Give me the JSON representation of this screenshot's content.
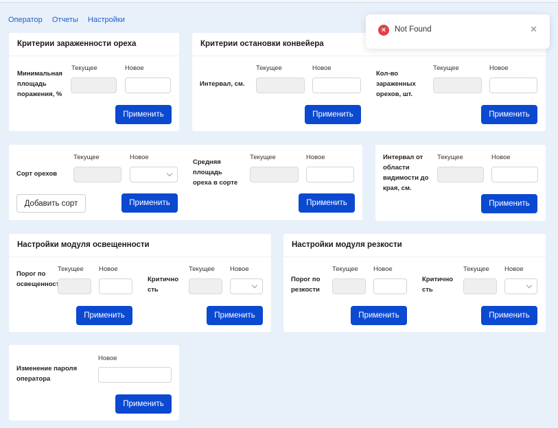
{
  "nav": {
    "operator": "Оператор",
    "reports": "Отчеты",
    "settings": "Настройки"
  },
  "labels": {
    "current": "Текущее",
    "new": "Новое",
    "apply": "Применить"
  },
  "cards": {
    "infection": {
      "title": "Критерии зараженности ореха",
      "field_label": "Минимальная площадь поражения, %"
    },
    "conveyor": {
      "title": "Критерии остановки конвейера",
      "interval_label": "Интервал, см.",
      "count_label": "Кол-во зараженных орехов, шт."
    },
    "sort": {
      "label": "Сорт орехов",
      "add_button": "Добавить сорт",
      "avg_label": "Средняя площадь ореха в сорте"
    },
    "edge": {
      "label": "Интервал от области видимости до края, см."
    },
    "light": {
      "title": "Настройки модуля освещенности",
      "threshold_label": "Порог по освещенности",
      "critical_label": "Критичность"
    },
    "sharp": {
      "title": "Настройки модуля резкости",
      "threshold_label": "Порог по резкости",
      "critical_label": "Критичность"
    },
    "password": {
      "label": "Изменение пароля оператора"
    }
  },
  "toast": {
    "message": "Not Found",
    "icon": "error-x-icon",
    "color": "#e0424b"
  },
  "colors": {
    "accent": "#0b49d1",
    "background": "#e8f0fa"
  }
}
